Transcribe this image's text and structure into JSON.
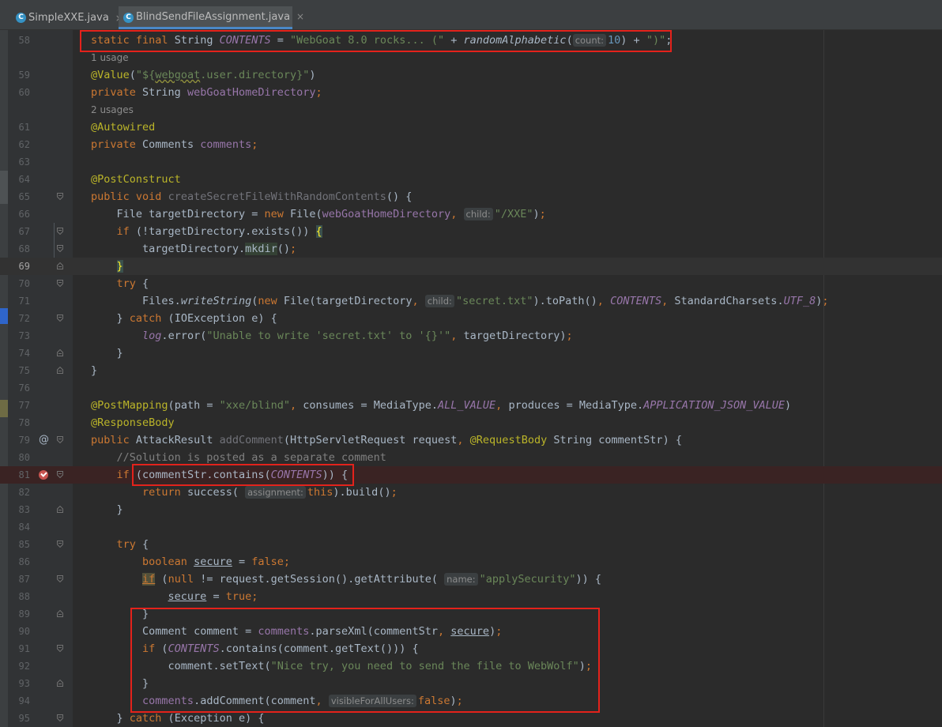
{
  "tabs": [
    {
      "label": "SimpleXXE.java",
      "close": "×",
      "active": false
    },
    {
      "label": "BlindSendFileAssignment.java",
      "close": "×",
      "active": true
    }
  ],
  "tab_icon_letter": "C",
  "line_numbers": [
    "58",
    "59",
    "60",
    "61",
    "62",
    "63",
    "64",
    "65",
    "66",
    "67",
    "68",
    "69",
    "70",
    "71",
    "72",
    "73",
    "74",
    "75",
    "76",
    "77",
    "78",
    "79",
    "80",
    "81",
    "82",
    "83",
    "84",
    "85",
    "86",
    "87",
    "88",
    "89",
    "90",
    "91",
    "92",
    "93",
    "94",
    "95"
  ],
  "usages": [
    "1 usage",
    "2 usages"
  ],
  "hints": {
    "count": "count:",
    "child": "child:",
    "assignment": "assignment:",
    "name": "name:",
    "visible": "visibleForAllUsers:"
  },
  "tokens": {
    "static": "static",
    "final": "final",
    "String": "String",
    "CONTENTS": "CONTENTS",
    "webgoat_str": "\"WebGoat 8.0 rocks... (\"",
    "randomAlphabetic": "randomAlphabetic",
    "ten": "10",
    "close_paren_str": "\")\"",
    "Value": "@Value",
    "value_str_open": "\"${",
    "value_str_mid": "webgoat",
    "value_str_close": ".user.directory}\"",
    "private": "private",
    "webGoatHomeDirectory": "webGoatHomeDirectory",
    "Autowired": "@Autowired",
    "Comments": "Comments",
    "comments": "comments",
    "PostConstruct": "@PostConstruct",
    "public": "public",
    "void": "void",
    "createSecret": "createSecretFileWithRandomContents",
    "File": "File",
    "targetDirectory": "targetDirectory",
    "new": "new",
    "xxe_str": "\"/XXE\"",
    "if": "if",
    "exists": "exists",
    "mkdir": "mkdir",
    "try": "try",
    "Files": "Files",
    "writeString": "writeString",
    "secret_str": "\"secret.txt\"",
    "toPath": "toPath",
    "StandardCharsets": "StandardCharsets",
    "UTF_8": "UTF_8",
    "catch": "catch",
    "IOException": "IOException",
    "e": "e",
    "log": "log",
    "error": "error",
    "unable_str": "\"Unable to write 'secret.txt' to '{}'\"",
    "PostMapping": "@PostMapping",
    "path": "path",
    "blind_str": "\"xxe/blind\"",
    "consumes": "consumes",
    "MediaType": "MediaType",
    "ALL_VALUE": "ALL_VALUE",
    "produces": "produces",
    "APPLICATION_JSON_VALUE": "APPLICATION_JSON_VALUE",
    "ResponseBody": "@ResponseBody",
    "AttackResult": "AttackResult",
    "addComment": "addComment",
    "HttpServletRequest": "HttpServletRequest",
    "request": "request",
    "RequestBody": "@RequestBody",
    "commentStr": "commentStr",
    "solution_comment": "//Solution is posted as a separate comment",
    "contains": "contains",
    "return": "return",
    "success": "success",
    "this": "this",
    "build": "build",
    "boolean": "boolean",
    "secure": "secure",
    "false": "false",
    "null": "null",
    "getSession": "getSession",
    "getAttribute": "getAttribute",
    "applySecurity_str": "\"applySecurity\"",
    "true": "true",
    "Comment": "Comment",
    "comment": "comment",
    "parseXml": "parseXml",
    "getText": "getText",
    "setText": "setText",
    "nice_try_str": "\"Nice try, you need to send the file to WebWolf\"",
    "Exception": "Exception"
  }
}
